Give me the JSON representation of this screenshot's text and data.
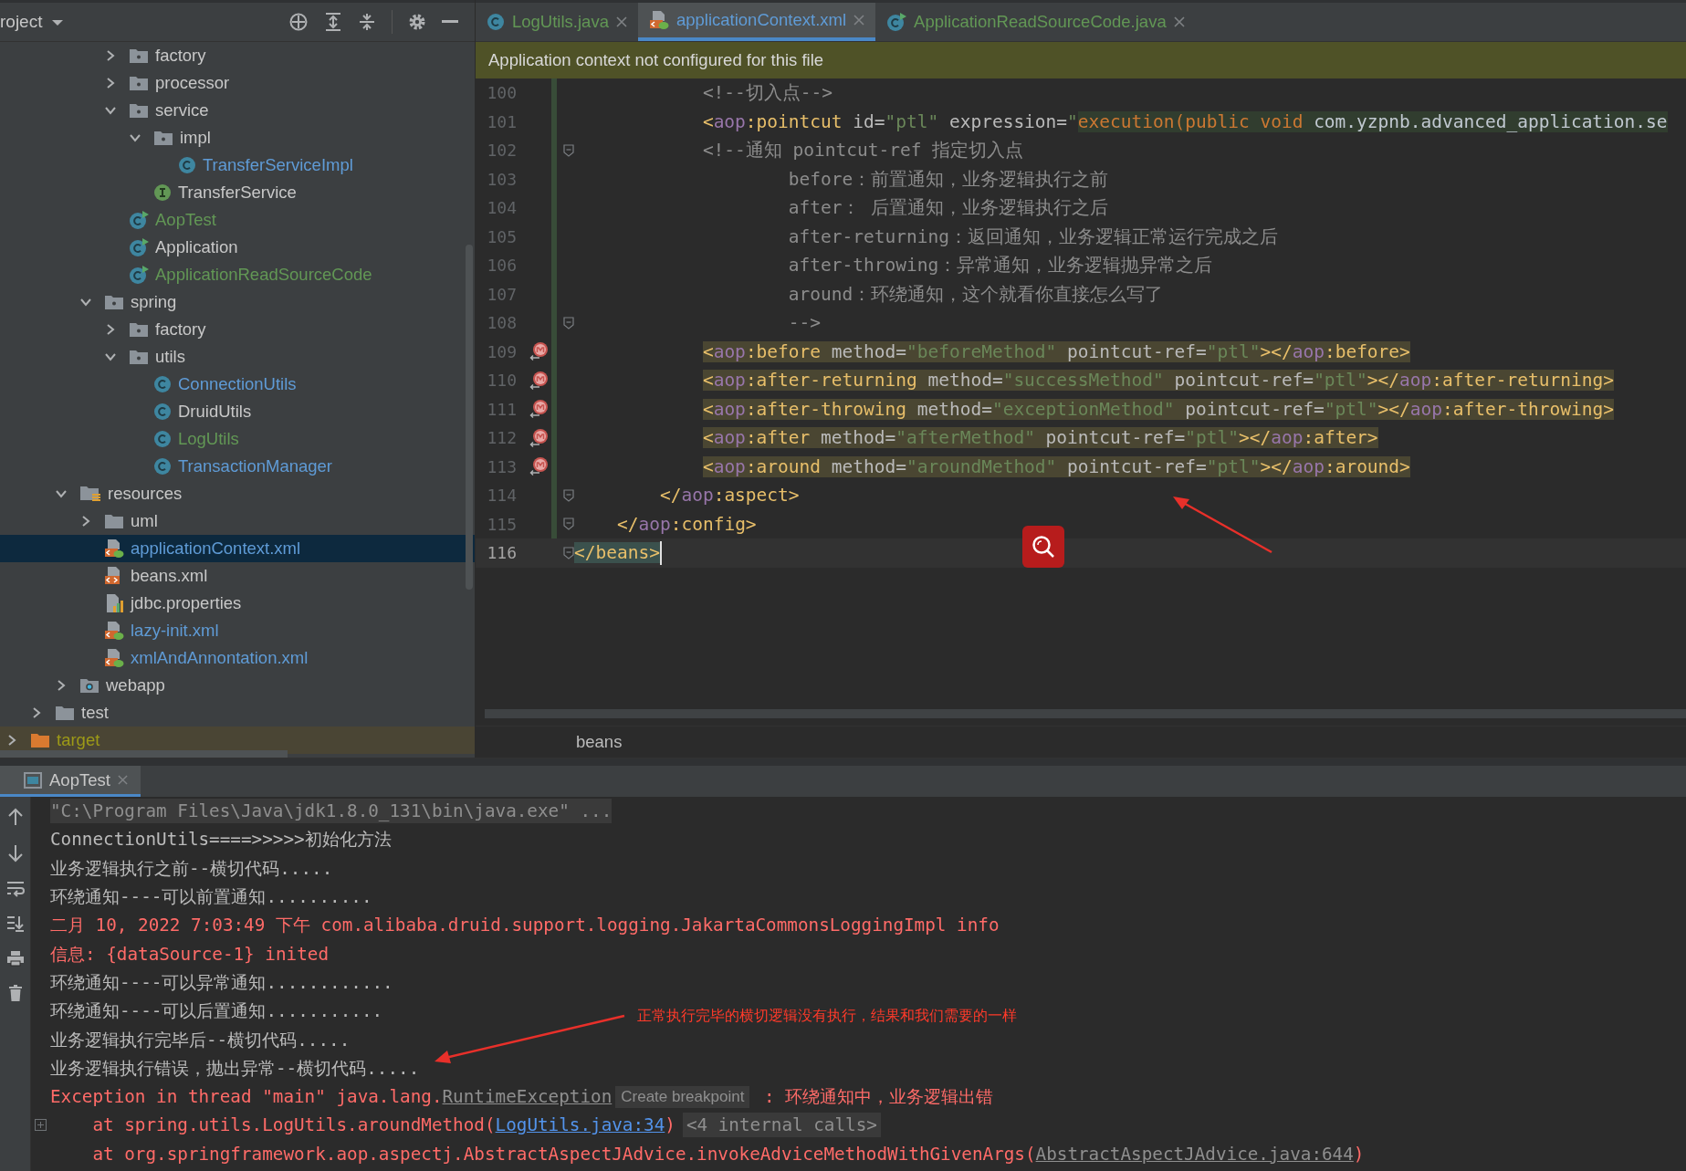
{
  "project_panel": {
    "title": "roject",
    "tree": [
      {
        "children": [
          {
            "children": [
              {
                "children": [
                  {
                    "children": [
                      {
                        "label": "factory",
                        "kind": "package",
                        "expanded": false,
                        "selected": false
                      },
                      {
                        "label": "processor",
                        "kind": "package",
                        "expanded": false,
                        "selected": false
                      },
                      {
                        "label": "service",
                        "kind": "package",
                        "expanded": true,
                        "selected": false,
                        "children": [
                          {
                            "label": "impl",
                            "kind": "package",
                            "expanded": true,
                            "selected": false,
                            "children": [
                              {
                                "label": "TransferServiceImpl",
                                "kind": "class",
                                "color": "#5f9bd6",
                                "selected": false
                              }
                            ]
                          },
                          {
                            "label": "TransferService",
                            "kind": "interface",
                            "selected": false
                          }
                        ]
                      },
                      {
                        "label": "AopTest",
                        "kind": "class-run",
                        "color": "#629755",
                        "selected": false
                      },
                      {
                        "label": "Application",
                        "kind": "class-run",
                        "selected": false
                      },
                      {
                        "label": "ApplicationReadSourceCode",
                        "kind": "class-run",
                        "color": "#629755",
                        "selected": false
                      }
                    ]
                  },
                  {
                    "label": "spring",
                    "kind": "package",
                    "expanded": true,
                    "selected": false,
                    "children": [
                      {
                        "label": "factory",
                        "kind": "package",
                        "expanded": false,
                        "selected": false
                      },
                      {
                        "label": "utils",
                        "kind": "package",
                        "expanded": true,
                        "selected": false,
                        "children": [
                          {
                            "label": "ConnectionUtils",
                            "kind": "class",
                            "color": "#5f9bd6",
                            "selected": false
                          },
                          {
                            "label": "DruidUtils",
                            "kind": "class",
                            "selected": false
                          },
                          {
                            "label": "LogUtils",
                            "kind": "class",
                            "color": "#629755",
                            "selected": false
                          },
                          {
                            "label": "TransactionManager",
                            "kind": "class",
                            "color": "#5f9bd6",
                            "selected": false
                          }
                        ]
                      }
                    ]
                  }
                ]
              },
              {
                "label": "resources",
                "kind": "resources",
                "expanded": true,
                "selected": false,
                "children": [
                  {
                    "label": "uml",
                    "kind": "folder",
                    "expanded": false,
                    "selected": false
                  },
                  {
                    "label": "applicationContext.xml",
                    "kind": "xml-spring",
                    "color": "#5f9bd6",
                    "selected": true
                  },
                  {
                    "label": "beans.xml",
                    "kind": "xml",
                    "selected": false
                  },
                  {
                    "label": "jdbc.properties",
                    "kind": "properties",
                    "selected": false
                  },
                  {
                    "label": "lazy-init.xml",
                    "kind": "xml-spring",
                    "color": "#5f9bd6",
                    "selected": false
                  },
                  {
                    "label": "xmlAndAnnontation.xml",
                    "kind": "xml-spring",
                    "color": "#5f9bd6",
                    "selected": false
                  }
                ]
              },
              {
                "label": "webapp",
                "kind": "web",
                "expanded": false,
                "selected": false
              }
            ]
          },
          {
            "label": "test",
            "kind": "folder",
            "expanded": false,
            "selected": false
          }
        ]
      },
      {
        "label": "target",
        "kind": "excluded",
        "color": "#9d9a17",
        "expanded": false,
        "selected": false
      }
    ]
  },
  "editor": {
    "tabs": [
      {
        "label": "LogUtils.java",
        "kind": "class",
        "color": "#629755",
        "selected": false
      },
      {
        "label": "applicationContext.xml",
        "kind": "xml-spring",
        "color": "#5f9bd6",
        "selected": true
      },
      {
        "label": "ApplicationReadSourceCode.java",
        "kind": "class-run",
        "color": "#629755",
        "selected": false
      }
    ],
    "banner": "Application context not configured for this file",
    "lines": [
      {
        "number": "100",
        "segments": [
          {
            "text": "            <!--切入点-->",
            "kind": "comment"
          }
        ]
      },
      {
        "number": "101",
        "segments": [
          {
            "text": "            <",
            "kind": "tag"
          },
          {
            "text": "aop",
            "kind": "ns"
          },
          {
            "text": ":pointcut",
            "kind": "tag"
          },
          {
            "text": " id=",
            "kind": "attr"
          },
          {
            "text": "\"ptl\"",
            "kind": "value"
          },
          {
            "text": " expression=",
            "kind": "attr"
          },
          {
            "text": "\"",
            "kind": "value"
          },
          {
            "text": "execution(public void",
            "kind": "inj-kw"
          },
          {
            "text": " com.yzpnb.advanced_application.se",
            "kind": "inj-text"
          }
        ]
      },
      {
        "number": "102",
        "foldable": true,
        "segments": [
          {
            "text": "            <!--通知 pointcut-ref 指定切入点",
            "kind": "comment"
          }
        ]
      },
      {
        "number": "103",
        "segments": [
          {
            "text": "                    before：前置通知，业务逻辑执行之前",
            "kind": "comment"
          }
        ]
      },
      {
        "number": "104",
        "segments": [
          {
            "text": "                    after： 后置通知，业务逻辑执行之后",
            "kind": "comment"
          }
        ]
      },
      {
        "number": "105",
        "segments": [
          {
            "text": "                    after-returning：返回通知，业务逻辑正常运行完成之后",
            "kind": "comment"
          }
        ]
      },
      {
        "number": "106",
        "segments": [
          {
            "text": "                    after-throwing：异常通知，业务逻辑抛异常之后",
            "kind": "comment"
          }
        ]
      },
      {
        "number": "107",
        "segments": [
          {
            "text": "                    around：环绕通知，这个就看你直接怎么写了",
            "kind": "comment"
          }
        ]
      },
      {
        "number": "108",
        "foldable": true,
        "segments": [
          {
            "text": "                    -->",
            "kind": "comment"
          }
        ]
      },
      {
        "number": "109",
        "has_advice": true,
        "highlighted": true,
        "segments": [
          {
            "text": "            <",
            "kind": "tag"
          },
          {
            "text": "aop",
            "kind": "ns"
          },
          {
            "text": ":before",
            "kind": "tag"
          },
          {
            "text": " method=",
            "kind": "attr"
          },
          {
            "text": "\"beforeMethod\"",
            "kind": "value"
          },
          {
            "text": " pointcut-ref=",
            "kind": "attr"
          },
          {
            "text": "\"ptl\"",
            "kind": "value"
          },
          {
            "text": "></",
            "kind": "tag"
          },
          {
            "text": "aop",
            "kind": "ns"
          },
          {
            "text": ":before>",
            "kind": "tag"
          }
        ]
      },
      {
        "number": "110",
        "has_advice": true,
        "highlighted": true,
        "segments": [
          {
            "text": "            <",
            "kind": "tag"
          },
          {
            "text": "aop",
            "kind": "ns"
          },
          {
            "text": ":after-returning",
            "kind": "tag"
          },
          {
            "text": " method=",
            "kind": "attr"
          },
          {
            "text": "\"successMethod\"",
            "kind": "value"
          },
          {
            "text": " pointcut-ref=",
            "kind": "attr"
          },
          {
            "text": "\"ptl\"",
            "kind": "value"
          },
          {
            "text": "></",
            "kind": "tag"
          },
          {
            "text": "aop",
            "kind": "ns"
          },
          {
            "text": ":after-returning>",
            "kind": "tag"
          }
        ]
      },
      {
        "number": "111",
        "has_advice": true,
        "highlighted": true,
        "segments": [
          {
            "text": "            <",
            "kind": "tag"
          },
          {
            "text": "aop",
            "kind": "ns"
          },
          {
            "text": ":after-throwing",
            "kind": "tag"
          },
          {
            "text": " method=",
            "kind": "attr"
          },
          {
            "text": "\"exceptionMethod\"",
            "kind": "value"
          },
          {
            "text": " pointcut-ref=",
            "kind": "attr"
          },
          {
            "text": "\"ptl\"",
            "kind": "value"
          },
          {
            "text": "></",
            "kind": "tag"
          },
          {
            "text": "aop",
            "kind": "ns"
          },
          {
            "text": ":after-throwing>",
            "kind": "tag"
          }
        ]
      },
      {
        "number": "112",
        "has_advice": true,
        "highlighted": true,
        "segments": [
          {
            "text": "            <",
            "kind": "tag"
          },
          {
            "text": "aop",
            "kind": "ns"
          },
          {
            "text": ":after",
            "kind": "tag"
          },
          {
            "text": " method=",
            "kind": "attr"
          },
          {
            "text": "\"afterMethod\"",
            "kind": "value"
          },
          {
            "text": " pointcut-ref=",
            "kind": "attr"
          },
          {
            "text": "\"ptl\"",
            "kind": "value"
          },
          {
            "text": "></",
            "kind": "tag"
          },
          {
            "text": "aop",
            "kind": "ns"
          },
          {
            "text": ":after>",
            "kind": "tag"
          }
        ]
      },
      {
        "number": "113",
        "has_advice": true,
        "highlighted": true,
        "segments": [
          {
            "text": "            <",
            "kind": "tag"
          },
          {
            "text": "aop",
            "kind": "ns"
          },
          {
            "text": ":around",
            "kind": "tag"
          },
          {
            "text": " method=",
            "kind": "attr"
          },
          {
            "text": "\"aroundMethod\"",
            "kind": "value"
          },
          {
            "text": " pointcut-ref=",
            "kind": "attr"
          },
          {
            "text": "\"ptl\"",
            "kind": "value"
          },
          {
            "text": "></",
            "kind": "tag"
          },
          {
            "text": "aop",
            "kind": "ns"
          },
          {
            "text": ":around>",
            "kind": "tag"
          }
        ]
      },
      {
        "number": "114",
        "foldable": true,
        "segments": [
          {
            "text": "        </",
            "kind": "tag"
          },
          {
            "text": "aop",
            "kind": "ns"
          },
          {
            "text": ":aspect>",
            "kind": "tag"
          }
        ]
      },
      {
        "number": "115",
        "foldable": true,
        "segments": [
          {
            "text": "    </",
            "kind": "tag"
          },
          {
            "text": "aop",
            "kind": "ns"
          },
          {
            "text": ":config>",
            "kind": "tag"
          }
        ]
      },
      {
        "number": "116",
        "foldable": true,
        "brace_matched": true,
        "current": true,
        "segments": [
          {
            "text": "</beans>",
            "kind": "tag"
          }
        ]
      }
    ],
    "breadcrumb": "beans"
  },
  "run_panel": {
    "tab": "AopTest",
    "annotation_note": "正常执行完毕的横切逻辑没有执行，结果和我们需要的一样",
    "lines": [
      {
        "kind": "cmd",
        "segments": [
          {
            "text": "\"C:\\Program Files\\Java\\jdk1.8.0_131\\bin\\java.exe\" ...",
            "kind": "text"
          }
        ]
      },
      {
        "kind": "out",
        "segments": [
          {
            "text": "ConnectionUtils====>>>>>初始化方法",
            "kind": "text"
          }
        ]
      },
      {
        "kind": "out",
        "segments": [
          {
            "text": "业务逻辑执行之前--横切代码.....",
            "kind": "text"
          }
        ]
      },
      {
        "kind": "out",
        "segments": [
          {
            "text": "环绕通知----可以前置通知..........",
            "kind": "text"
          }
        ]
      },
      {
        "kind": "err",
        "segments": [
          {
            "text": "二月 10, 2022 7:03:49 下午 com.alibaba.druid.support.logging.JakartaCommonsLoggingImpl info",
            "kind": "text"
          }
        ]
      },
      {
        "kind": "err",
        "segments": [
          {
            "text": "信息: {dataSource-1} inited",
            "kind": "text"
          }
        ]
      },
      {
        "kind": "out",
        "segments": [
          {
            "text": "环绕通知----可以异常通知............",
            "kind": "text"
          }
        ]
      },
      {
        "kind": "out",
        "segments": [
          {
            "text": "环绕通知----可以后置通知...........",
            "kind": "text"
          }
        ]
      },
      {
        "kind": "out",
        "segments": [
          {
            "text": "业务逻辑执行完毕后--横切代码.....",
            "kind": "text"
          }
        ]
      },
      {
        "kind": "out",
        "segments": [
          {
            "text": "业务逻辑执行错误，抛出异常--横切代码.....",
            "kind": "text"
          }
        ]
      },
      {
        "kind": "err",
        "segments": [
          {
            "text": "Exception in thread \"main\" java.lang.",
            "kind": "text"
          },
          {
            "text": "RuntimeException",
            "kind": "link-muted"
          },
          {
            "text": "Create breakpoint",
            "kind": "chip"
          },
          {
            "text": " : 环绕通知中，业务逻辑出错",
            "kind": "text"
          }
        ]
      },
      {
        "kind": "err",
        "foldable": true,
        "segments": [
          {
            "text": "    at spring.utils.LogUtils.aroundMethod(",
            "kind": "text"
          },
          {
            "text": "LogUtils.java:34",
            "kind": "link"
          },
          {
            "text": ")",
            "kind": "text"
          },
          {
            "text": "<4 internal calls>",
            "kind": "chip-mono"
          }
        ]
      },
      {
        "kind": "err",
        "segments": [
          {
            "text": "    at org.springframework.aop.aspectj.AbstractAspectJAdvice.invokeAdviceMethodWithGivenArgs(",
            "kind": "text"
          },
          {
            "text": "AbstractAspectJAdvice.java:644",
            "kind": "link-muted"
          },
          {
            "text": ")",
            "kind": "text"
          }
        ]
      }
    ]
  }
}
